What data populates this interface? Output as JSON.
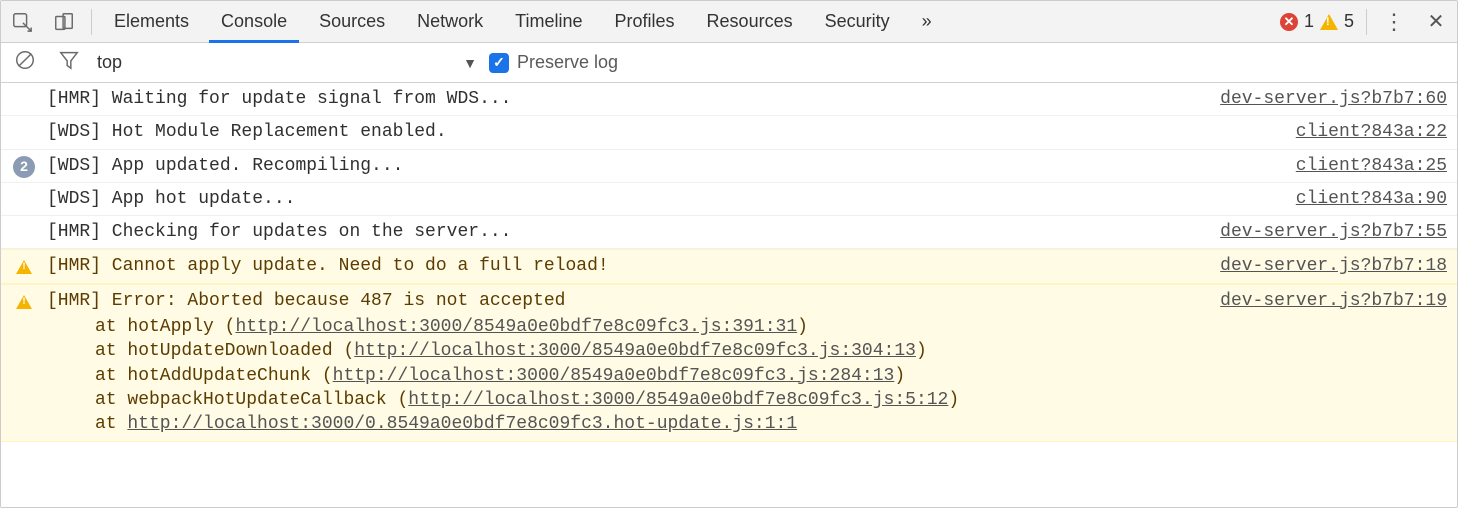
{
  "tabs": [
    "Elements",
    "Console",
    "Sources",
    "Network",
    "Timeline",
    "Profiles",
    "Resources",
    "Security"
  ],
  "active_tab": "Console",
  "overflow_glyph": "»",
  "status": {
    "errors": 1,
    "warnings": 5
  },
  "console_toolbar": {
    "context": "top",
    "preserve_label": "Preserve log",
    "preserve_checked": true
  },
  "logs": [
    {
      "type": "log",
      "count": null,
      "msg": "[HMR] Waiting for update signal from WDS...",
      "src": "dev-server.js?b7b7:60"
    },
    {
      "type": "log",
      "count": null,
      "msg": "[WDS] Hot Module Replacement enabled.",
      "src": "client?843a:22"
    },
    {
      "type": "log",
      "count": 2,
      "msg": "[WDS] App updated. Recompiling...",
      "src": "client?843a:25"
    },
    {
      "type": "log",
      "count": null,
      "msg": "[WDS] App hot update...",
      "src": "client?843a:90"
    },
    {
      "type": "log",
      "count": null,
      "msg": "[HMR] Checking for updates on the server...",
      "src": "dev-server.js?b7b7:55"
    },
    {
      "type": "warn",
      "count": null,
      "msg": "[HMR] Cannot apply update. Need to do a full reload!",
      "src": "dev-server.js?b7b7:18"
    },
    {
      "type": "warn",
      "count": null,
      "msg": "[HMR] Error: Aborted because 487 is not accepted",
      "src": "dev-server.js?b7b7:19",
      "stack": [
        {
          "fn": "hotApply",
          "url": "http://localhost:3000/8549a0e0bdf7e8c09fc3.js:391:31"
        },
        {
          "fn": "hotUpdateDownloaded",
          "url": "http://localhost:3000/8549a0e0bdf7e8c09fc3.js:304:13"
        },
        {
          "fn": "hotAddUpdateChunk",
          "url": "http://localhost:3000/8549a0e0bdf7e8c09fc3.js:284:13"
        },
        {
          "fn": "webpackHotUpdateCallback",
          "url": "http://localhost:3000/8549a0e0bdf7e8c09fc3.js:5:12"
        },
        {
          "fn": "",
          "url": "http://localhost:3000/0.8549a0e0bdf7e8c09fc3.hot-update.js:1:1"
        }
      ]
    }
  ]
}
